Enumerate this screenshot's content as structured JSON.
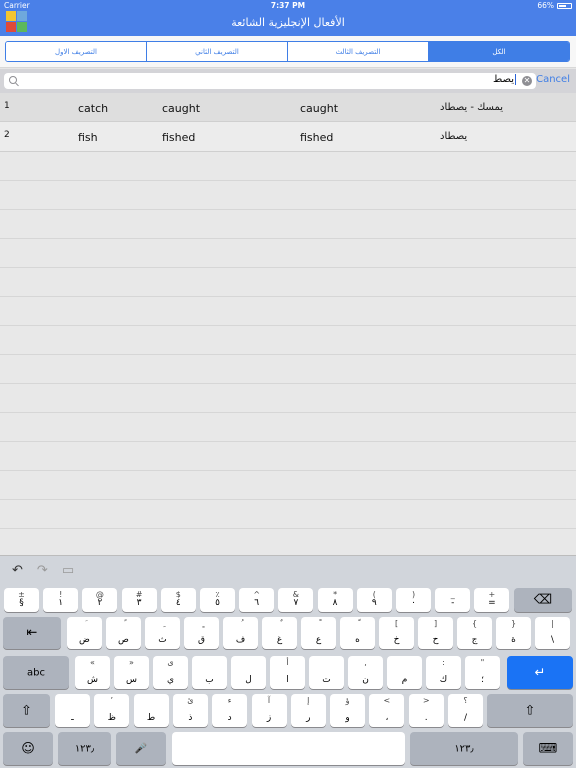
{
  "status": {
    "carrier": "Carrier",
    "time": "7:37 PM",
    "battery": "66%",
    "battery_level": 0.66
  },
  "header": {
    "title": "الأفعال الإنجليزية الشائعة",
    "icon": "app-grid-icon"
  },
  "segments": [
    {
      "label": "الكل",
      "active": true
    },
    {
      "label": "التصريف الثالث",
      "active": false
    },
    {
      "label": "التصريف الثاني",
      "active": false
    },
    {
      "label": "التصريف الاول",
      "active": false
    }
  ],
  "search": {
    "value": "يصط",
    "cancel_label": "Cancel"
  },
  "rows": [
    {
      "num": "1",
      "base": "catch",
      "past": "caught",
      "participle": "caught",
      "arabic": "يمسك - يصطاد"
    },
    {
      "num": "2",
      "base": "fish",
      "past": "fished",
      "participle": "fished",
      "arabic": "يصطاد"
    }
  ],
  "keyboard": {
    "tools": {
      "undo": "↶",
      "redo": "↷",
      "paste": "▭"
    },
    "row1": [
      {
        "top": "±",
        "bot": "§"
      },
      {
        "top": "!",
        "bot": "١"
      },
      {
        "top": "@",
        "bot": "٢"
      },
      {
        "top": "#",
        "bot": "٣"
      },
      {
        "top": "$",
        "bot": "٤"
      },
      {
        "top": "٪",
        "bot": "٥"
      },
      {
        "top": "^",
        "bot": "٦"
      },
      {
        "top": "&",
        "bot": "٧"
      },
      {
        "top": "*",
        "bot": "٨"
      },
      {
        "top": "(",
        "bot": "٩"
      },
      {
        "top": ")",
        "bot": "٠"
      },
      {
        "top": "_",
        "bot": "-"
      },
      {
        "top": "+",
        "bot": "="
      }
    ],
    "row2": [
      {
        "top": "َ",
        "bot": "ض"
      },
      {
        "top": "ً",
        "bot": "ص"
      },
      {
        "top": "ِ",
        "bot": "ث"
      },
      {
        "top": "ٍ",
        "bot": "ق"
      },
      {
        "top": "ُ",
        "bot": "ف"
      },
      {
        "top": "ٌ",
        "bot": "غ"
      },
      {
        "top": "ْ",
        "bot": "ع"
      },
      {
        "top": "ّ",
        "bot": "ه"
      },
      {
        "top": "[",
        "bot": "خ"
      },
      {
        "top": "]",
        "bot": "ح"
      },
      {
        "top": "{",
        "bot": "ج"
      },
      {
        "top": "}",
        "bot": "ة"
      },
      {
        "top": "|",
        "bot": "\\"
      }
    ],
    "row3": [
      {
        "top": "«",
        "bot": "ش"
      },
      {
        "top": "»",
        "bot": "س"
      },
      {
        "top": "ى",
        "bot": "ي"
      },
      {
        "top": "",
        "bot": "ب"
      },
      {
        "top": "",
        "bot": "ل"
      },
      {
        "top": "أ",
        "bot": "ا"
      },
      {
        "top": "",
        "bot": "ت"
      },
      {
        "top": ",",
        "bot": "ن"
      },
      {
        "top": "",
        "bot": "م"
      },
      {
        "top": ":",
        "bot": "ك"
      },
      {
        "top": "\"",
        "bot": "؛"
      }
    ],
    "row4": [
      {
        "top": "",
        "bot": "ـ"
      },
      {
        "top": "’",
        "bot": "ظ"
      },
      {
        "top": "",
        "bot": "ط"
      },
      {
        "top": "ئ",
        "bot": "ذ"
      },
      {
        "top": "ء",
        "bot": "د"
      },
      {
        "top": "آ",
        "bot": "ز"
      },
      {
        "top": "إ",
        "bot": "ر"
      },
      {
        "top": "ؤ",
        "bot": "و"
      },
      {
        "top": "<",
        "bot": "،"
      },
      {
        "top": ">",
        "bot": "."
      },
      {
        "top": "؟",
        "bot": "/"
      }
    ],
    "labels": {
      "delete": "⌫",
      "tab": "⇤",
      "abc": "abc",
      "return": "↵",
      "shift_left": "⇧",
      "shift_right": "⇧",
      "emoji": "☺",
      "numbers_left": "١٢٣٫",
      "mic": "🎤",
      "numbers_right": "١٢٣٫",
      "hide": "⌨"
    }
  }
}
